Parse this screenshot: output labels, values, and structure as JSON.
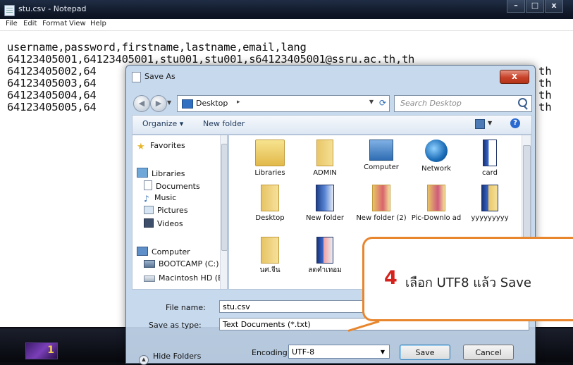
{
  "notepad": {
    "title": "stu.csv - Notepad",
    "window_controls": {
      "minimize": "–",
      "maximize": "□",
      "close": "x"
    },
    "menu": [
      "File",
      "Edit",
      "Format",
      "View",
      "Help"
    ],
    "header_line": "username,password,firstname,lastname,email,lang",
    "row1": "64123405001,64123405001,stu001,stu001,s64123405001@ssru.ac.th,th",
    "rows_visible_prefix": [
      "64123405002,64",
      "64123405003,64",
      "64123405004,64",
      "64123405005,64"
    ],
    "rows_visible_suffix": [
      "th",
      "th",
      "th",
      "th"
    ]
  },
  "dialog": {
    "title": "Save As",
    "close_label": "x",
    "address": {
      "location": "Desktop",
      "separator": "▸"
    },
    "search_placeholder": "Search Desktop",
    "toolbar": {
      "organize": "Organize ▾",
      "new_folder": "New folder",
      "help": "?"
    },
    "nav": {
      "favorites": "Favorites",
      "libraries": "Libraries",
      "documents": "Documents",
      "music": "Music",
      "pictures": "Pictures",
      "videos": "Videos",
      "computer": "Computer",
      "bootcamp": "BOOTCAMP (C:)",
      "macintosh": "Macintosh HD (E"
    },
    "files": [
      {
        "label": "Libraries",
        "icon": "libraries-icon"
      },
      {
        "label": "ADMIN",
        "icon": "user-folder-icon"
      },
      {
        "label": "Computer",
        "icon": "computer-icon"
      },
      {
        "label": "Network",
        "icon": "network-icon"
      },
      {
        "label": "card",
        "icon": "book-icon"
      },
      {
        "label": "Desktop",
        "icon": "folder-icon"
      },
      {
        "label": "New folder",
        "icon": "folder-icon"
      },
      {
        "label": "New folder (2)",
        "icon": "folder-icon"
      },
      {
        "label": "Pic-Downlo ad",
        "icon": "folder-icon"
      },
      {
        "label": "yyyyyyyyy",
        "icon": "book-icon"
      },
      {
        "label": "นศ.จีน",
        "icon": "folder-icon"
      },
      {
        "label": "ลดคำเทอม",
        "icon": "book-icon"
      }
    ],
    "file_name_label": "File name:",
    "file_name_value": "stu.csv",
    "save_as_type_label": "Save as type:",
    "save_as_type_value": "Text Documents (*.txt)",
    "hide_folders": "Hide Folders",
    "encoding_label": "Encoding:",
    "encoding_value": "UTF-8",
    "save_button": "Save",
    "cancel_button": "Cancel"
  },
  "callout": {
    "step_number": "4",
    "text": "เลือก UTF8 แล้ว Save"
  },
  "colors": {
    "callout_border": "#e8862e",
    "step_number": "#d4221c",
    "dialog_glass": "#c3d6ec",
    "close_button": "#c8422a"
  }
}
